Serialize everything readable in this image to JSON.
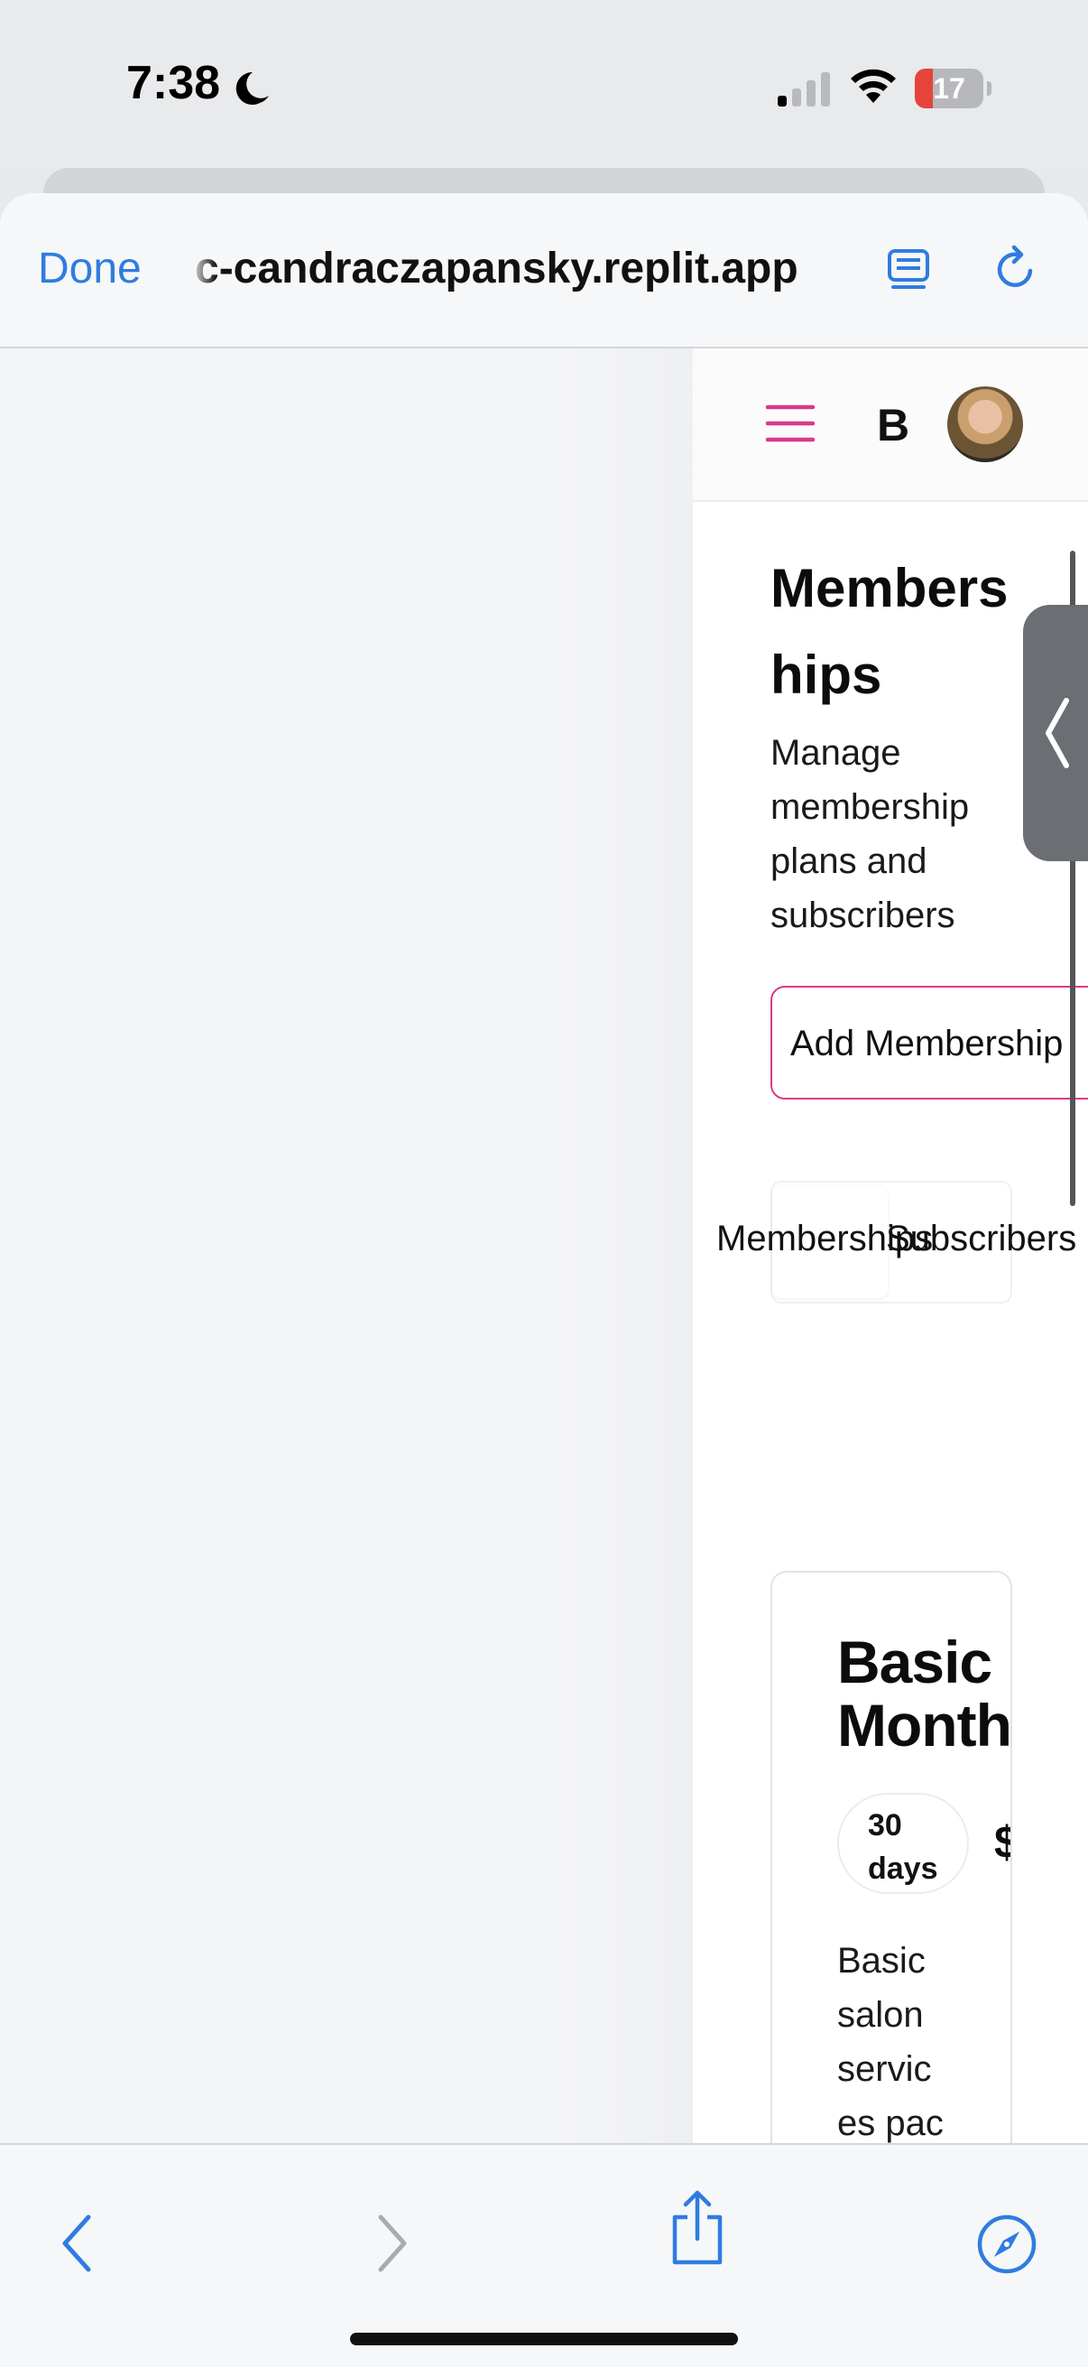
{
  "status_bar": {
    "time": "7:38",
    "battery_level": "17",
    "battery_fraction": 0.17
  },
  "browser": {
    "done_label": "Done",
    "url": "c-candraczapansky.replit.app",
    "icons": [
      "reader-icon",
      "reload-icon",
      "back-icon",
      "forward-icon",
      "share-icon",
      "compass-icon"
    ]
  },
  "app": {
    "brand_initial": "B",
    "page_title": "Memberships",
    "page_subtitle": "Manage membership plans and subscribers",
    "add_button_label": "Add Membership",
    "tabs": [
      {
        "label": "Memberships"
      },
      {
        "label": "Subscribers"
      }
    ],
    "plan": {
      "name": "Basic Monthly",
      "duration": "30 days",
      "price": "$",
      "description": "Basic salon services package"
    }
  },
  "colors": {
    "accent_pink": "#d83a8a",
    "ios_blue": "#2f7ce0"
  }
}
